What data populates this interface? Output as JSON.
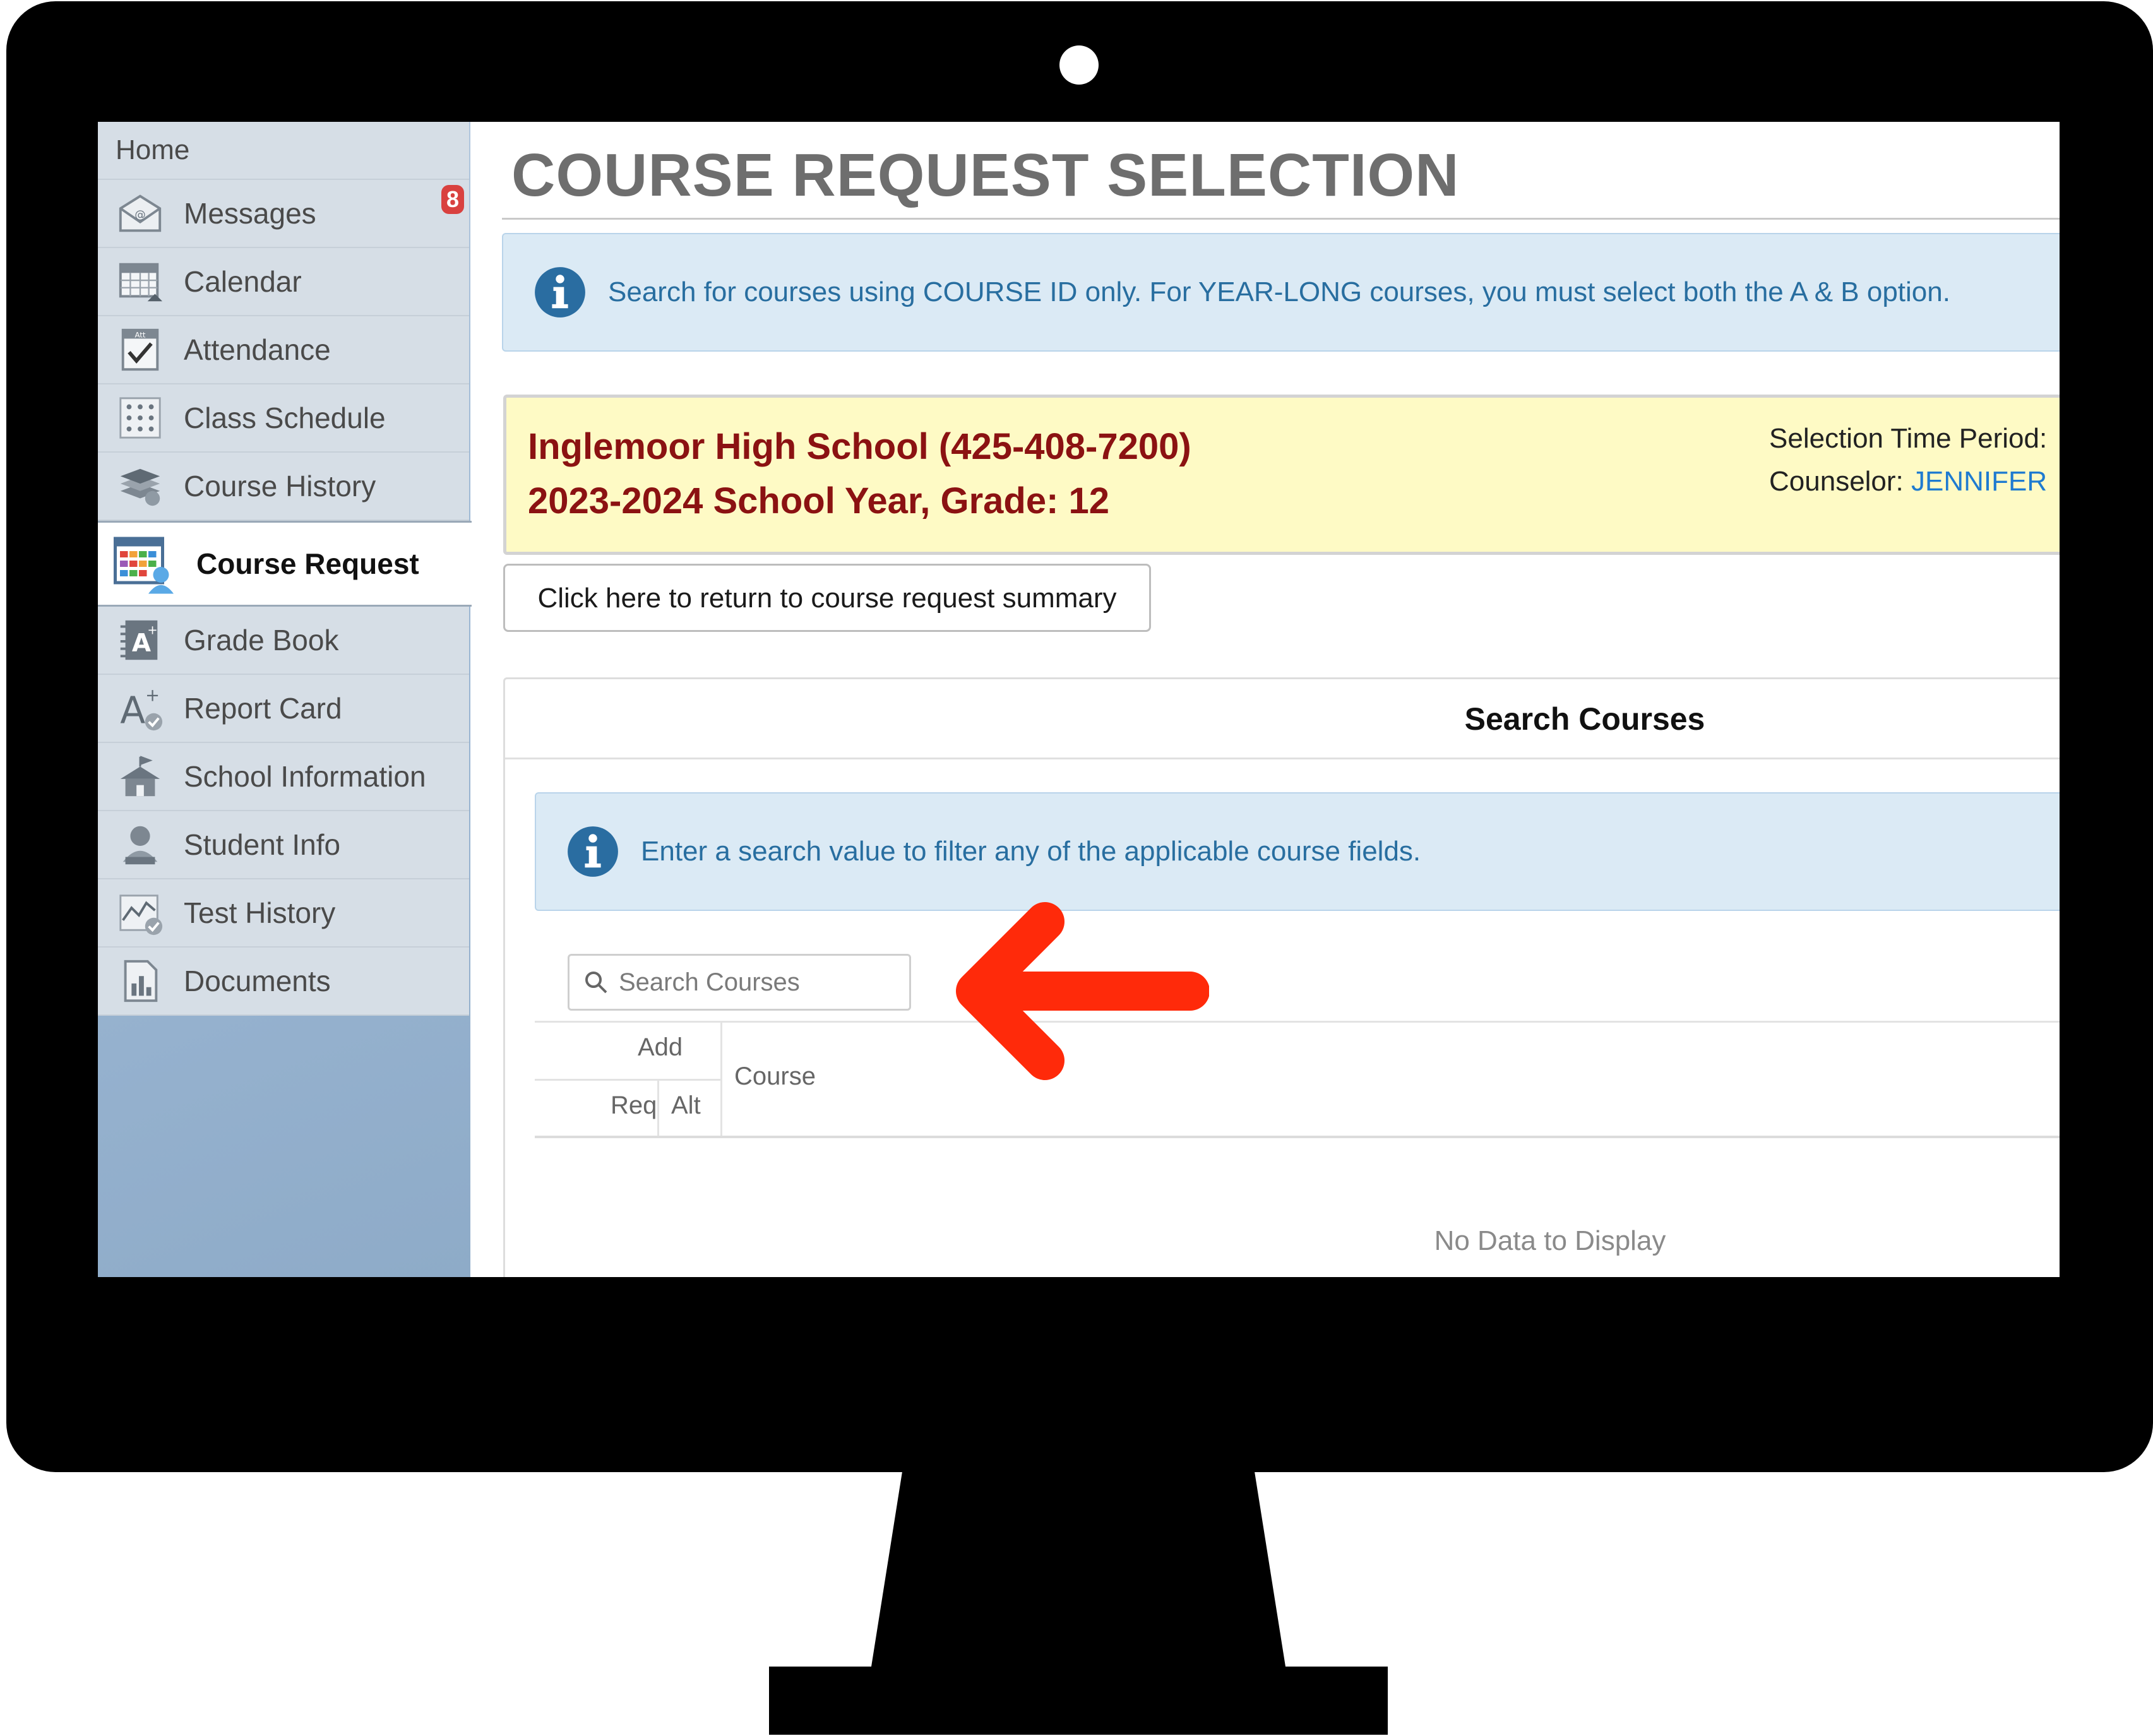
{
  "sidebar": {
    "home_label": "Home",
    "items": [
      {
        "label": "Messages",
        "icon": "envelope-icon",
        "badge": "8"
      },
      {
        "label": "Calendar",
        "icon": "calendar-icon"
      },
      {
        "label": "Attendance",
        "icon": "attendance-icon"
      },
      {
        "label": "Class Schedule",
        "icon": "schedule-icon"
      },
      {
        "label": "Course History",
        "icon": "course-history-icon"
      },
      {
        "label": "Course Request",
        "icon": "course-request-icon",
        "active": true
      },
      {
        "label": "Grade Book",
        "icon": "grade-book-icon"
      },
      {
        "label": "Report Card",
        "icon": "report-card-icon"
      },
      {
        "label": "School Information",
        "icon": "school-icon"
      },
      {
        "label": "Student Info",
        "icon": "student-icon"
      },
      {
        "label": "Test History",
        "icon": "test-history-icon"
      },
      {
        "label": "Documents",
        "icon": "documents-icon"
      }
    ]
  },
  "main": {
    "title": "COURSE REQUEST SELECTION",
    "info_message": "Search for courses using COURSE ID only. For YEAR-LONG courses, you must select both the A & B option.",
    "school": {
      "name": "Inglemoor High School (425-408-7200)",
      "year": "2023-2024 School Year, Grade: 12",
      "period_label": "Selection Time Period:",
      "counselor_label": "Counselor:",
      "counselor_name": "JENNIFER"
    },
    "return_button": "Click here to return to course request summary",
    "search_panel": {
      "title": "Search Courses",
      "info_message": "Enter a search value to filter any of the applicable course fields.",
      "search_placeholder": "Search Courses",
      "search_value": "",
      "columns": {
        "add": "Add",
        "req": "Req",
        "alt": "Alt",
        "course": "Course"
      },
      "empty_message": "No Data to Display"
    }
  },
  "colors": {
    "accent_red": "#8b1212",
    "info_text": "#286ea0",
    "arrow": "#ff2a0a",
    "counselor_link": "#1f7bd0"
  }
}
